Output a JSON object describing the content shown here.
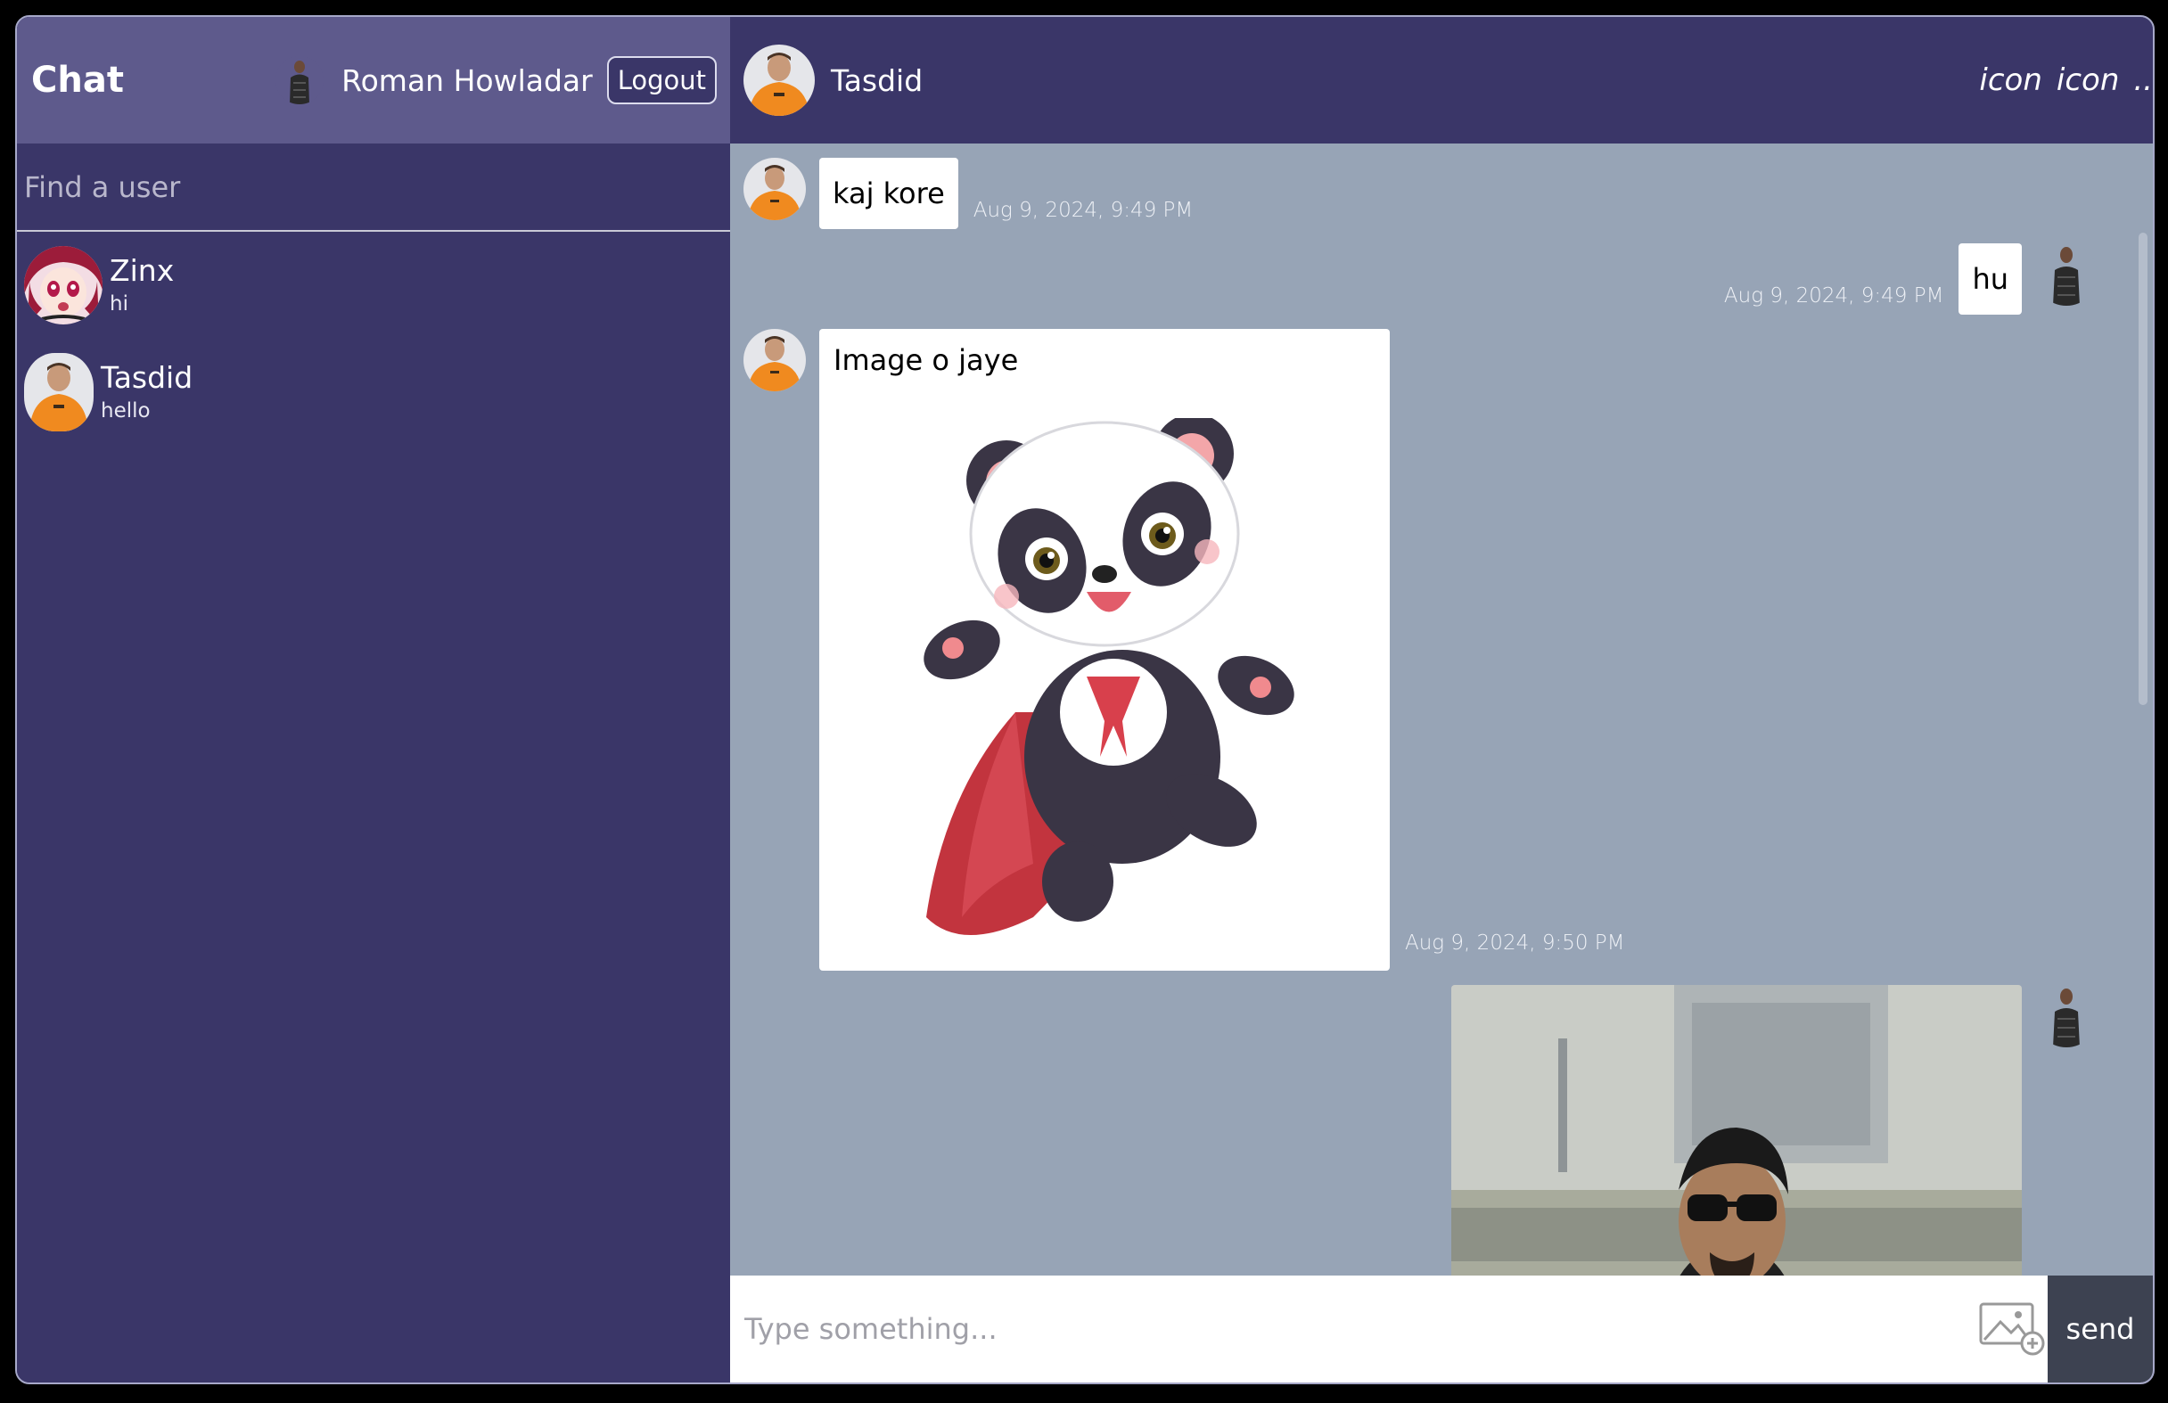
{
  "navbar": {
    "logo": "Chat",
    "current_user": "Roman Howladar",
    "logout_label": "Logout"
  },
  "search": {
    "placeholder": "Find a user"
  },
  "users": [
    {
      "name": "Zinx",
      "last_message": "hi"
    },
    {
      "name": "Tasdid",
      "last_message": "hello"
    }
  ],
  "chat_header": {
    "name": "Tasdid",
    "icons": [
      "icon",
      "icon",
      ".."
    ]
  },
  "messages": [
    {
      "from": "Tasdid",
      "text": "kaj kore",
      "time": "Aug 9, 2024, 9:49 PM"
    },
    {
      "from": "Roman Howladar",
      "text": "hu",
      "time": "Aug 9, 2024, 9:49 PM"
    },
    {
      "from": "Tasdid",
      "text": "Image o jaye",
      "time": "Aug 9, 2024, 9:50 PM",
      "image": "panda"
    },
    {
      "from": "Roman Howladar",
      "text": "",
      "image": "photo"
    }
  ],
  "input": {
    "placeholder": "Type something...",
    "send_label": "send"
  },
  "colors": {
    "sidebar": "#3a3668",
    "navbar": "#5e5a8c",
    "chat_bg": "#97a4b6",
    "send_button": "#3d4251"
  }
}
